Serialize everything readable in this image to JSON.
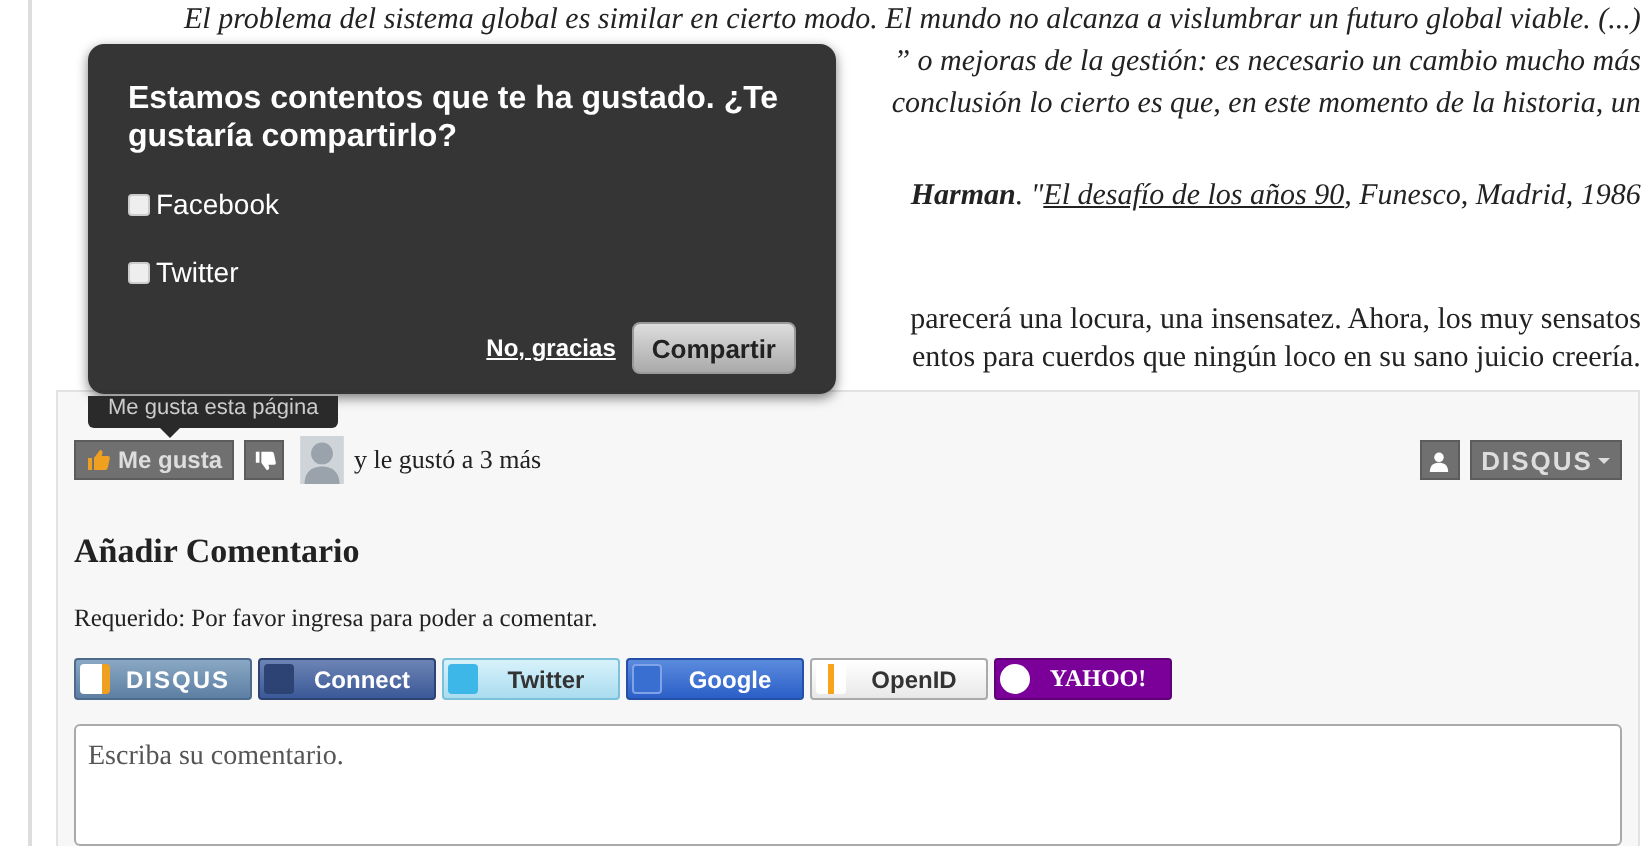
{
  "article": {
    "quote_lines": [
      {
        "text": "El problema del sistema global es similar en cierto modo. El mundo no alcanza a vislumbrar un futuro global viable. (...)",
        "kind": "full"
      },
      {
        "text": "” o mejoras de la gestión: es necesario un cambio mucho más",
        "kind": "fragment"
      },
      {
        "text": "conclusión lo cierto es que, en este momento de la historia, un",
        "kind": "fragment"
      }
    ],
    "attribution": {
      "author": "Harman",
      "separator": ". \"",
      "link": "El desafío de los años 90",
      "rest": ", Funesco, Madrid, 1986"
    },
    "paragraph_lines": [
      {
        "text": "parecerá una locura, una insensatez. Ahora, los muy sensatos"
      },
      {
        "text": "entos para cuerdos que ningún loco en su sano juicio creería."
      }
    ]
  },
  "share_popup": {
    "title": "Estamos contentos que te ha gustado. ¿Te gustaría compartirlo?",
    "options": [
      {
        "label": "Facebook",
        "checked": false
      },
      {
        "label": "Twitter",
        "checked": false
      }
    ],
    "cancel": "No, gracias",
    "submit": "Compartir"
  },
  "tooltip": "Me gusta esta página",
  "reactions": {
    "like": "Me gusta",
    "liked_by": "y le gustó a 3 más",
    "brand": "DISQUS"
  },
  "comments": {
    "heading": "Añadir Comentario",
    "notice": "Requerido: Por favor ingresa para poder a comentar.",
    "login_buttons": [
      {
        "label": "DISQUS",
        "kind": "disqus"
      },
      {
        "label": "Connect",
        "kind": "facebook"
      },
      {
        "label": "Twitter",
        "kind": "twitter"
      },
      {
        "label": "Google",
        "kind": "google"
      },
      {
        "label": "OpenID",
        "kind": "openid"
      },
      {
        "label": "YAHOO!",
        "kind": "yahoo"
      }
    ],
    "placeholder": "Escriba su comentario."
  }
}
